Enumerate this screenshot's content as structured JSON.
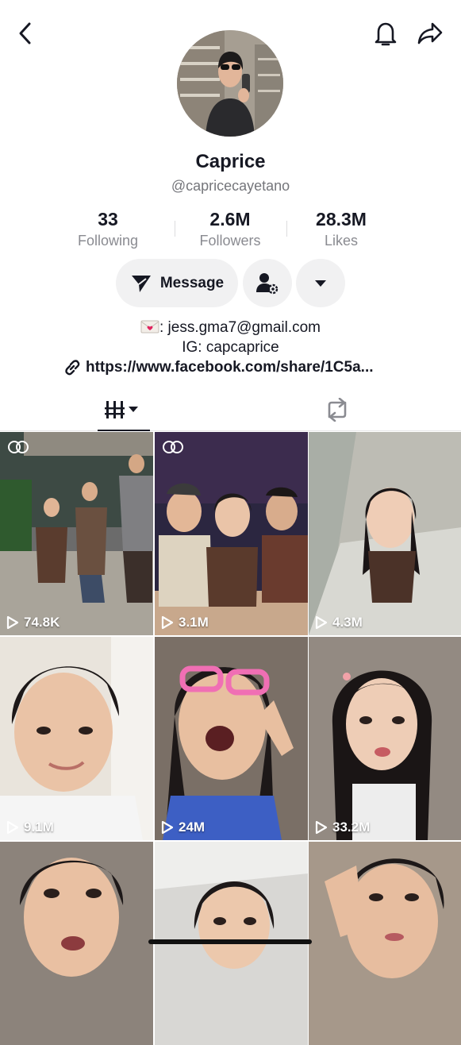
{
  "profile": {
    "name": "Caprice",
    "handle": "@capricecayetano"
  },
  "stats": [
    {
      "value": "33",
      "label": "Following"
    },
    {
      "value": "2.6M",
      "label": "Followers"
    },
    {
      "value": "28.3M",
      "label": "Likes"
    }
  ],
  "actions": {
    "message_label": "Message"
  },
  "bio": {
    "email_line": ": jess.gma7@gmail.com",
    "ig_line": "IG: capcaprice",
    "link": "https://www.facebook.com/share/1C5a..."
  },
  "icons": {
    "back": "chevron-left-icon",
    "bell": "bell-icon",
    "share": "share-arrow-icon",
    "message": "send-plane-icon",
    "add_friend": "person-gear-icon",
    "more": "caret-down-icon",
    "email": "love-letter-icon",
    "link": "link-icon",
    "videos_tab": "grid-icon",
    "repost_tab": "repost-icon",
    "play": "play-icon",
    "collab": "collab-icon"
  },
  "videos": [
    {
      "views": "74.8K",
      "collab": true
    },
    {
      "views": "3.1M",
      "collab": true
    },
    {
      "views": "4.3M",
      "collab": false
    },
    {
      "views": "9.1M",
      "collab": false
    },
    {
      "views": "24M",
      "collab": false
    },
    {
      "views": "33.2M",
      "collab": false
    },
    {
      "views": "",
      "collab": false
    },
    {
      "views": "",
      "collab": false
    },
    {
      "views": "",
      "collab": false
    }
  ],
  "colors": {
    "text": "#161823",
    "secondary": "#75767b",
    "button_bg": "#f1f1f2"
  }
}
